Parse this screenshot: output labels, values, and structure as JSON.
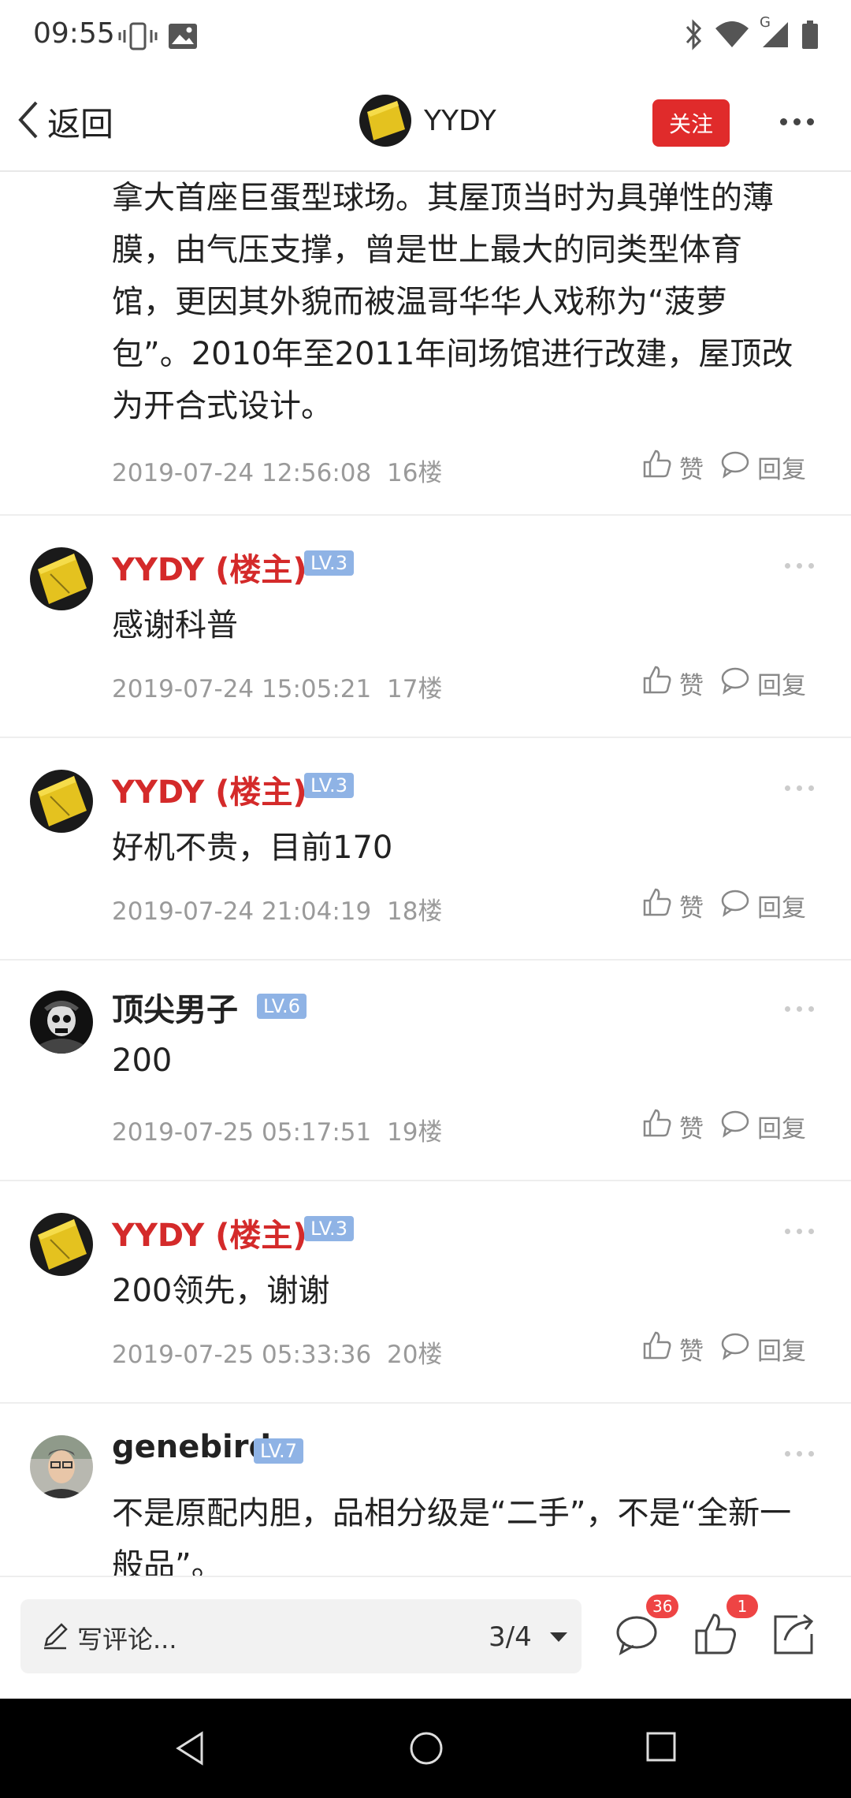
{
  "status_bar": {
    "time": "09:55",
    "network": "G"
  },
  "nav": {
    "back_label": "返回",
    "title": "YYDY",
    "follow_label": "关注"
  },
  "first_post_text": [
    "拿大首座巨蛋型球场。其屋顶当时为具弹性的薄",
    "膜，由气压支撑，曾是世上最大的同类型体育",
    "馆，更因其外貌而被温哥华华人戏称为“菠萝",
    "包”。2010年至2011年间场馆进行改建，屋顶改",
    "为开合式设计。"
  ],
  "first_post_meta": {
    "time": "2019-07-24 12:56:08",
    "floor": "16楼",
    "like": "赞",
    "reply": "回复"
  },
  "posts": [
    {
      "user": "YYDY (楼主)",
      "level": "LV.3",
      "host": true,
      "text": "感谢科普",
      "time": "2019-07-24 15:05:21",
      "floor": "17楼",
      "like": "赞",
      "reply": "回复"
    },
    {
      "user": "YYDY (楼主)",
      "level": "LV.3",
      "host": true,
      "text": "好机不贵，目前170",
      "time": "2019-07-24 21:04:19",
      "floor": "18楼",
      "like": "赞",
      "reply": "回复"
    },
    {
      "user": "顶尖男子",
      "level": "LV.6",
      "host": false,
      "text": "200",
      "time": "2019-07-25 05:17:51",
      "floor": "19楼",
      "like": "赞",
      "reply": "回复"
    },
    {
      "user": "YYDY (楼主)",
      "level": "LV.3",
      "host": true,
      "text": "200领先，谢谢",
      "time": "2019-07-25 05:33:36",
      "floor": "20楼",
      "like": "赞",
      "reply": "回复"
    },
    {
      "user": "genebird",
      "level": "LV.7",
      "host": false,
      "text": "不是原配内胆，品相分级是“二手”，不是“全新一",
      "text2": "般品”。"
    }
  ],
  "bottom_bar": {
    "comment_placeholder": "写评论...",
    "page_indicator": "3/4",
    "comment_count": "36",
    "like_count": "1"
  },
  "colors": {
    "host_name": "#d42a2a",
    "follow_bg": "#e02b2b",
    "level_badge": "#8fb3e5",
    "badge": "#ee4444"
  }
}
